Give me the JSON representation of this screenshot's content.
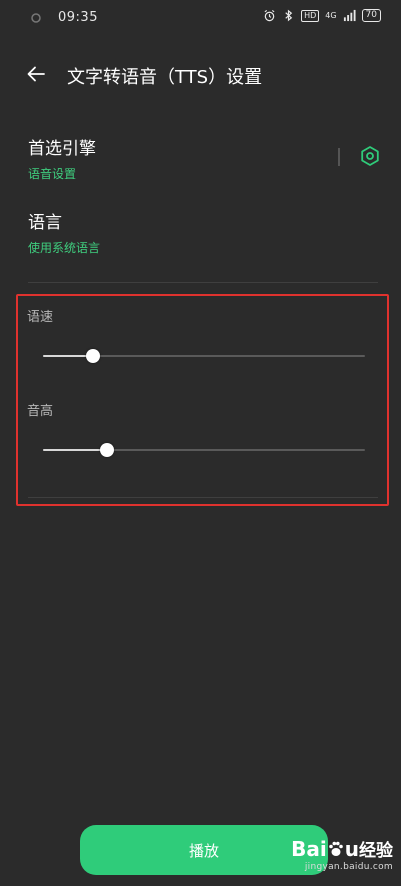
{
  "status_bar": {
    "time": "09:35",
    "hd_badge": "HD",
    "signal_text": "4G",
    "battery": "70",
    "icons": [
      "alarm-icon",
      "bluetooth-icon",
      "hd-badge",
      "signal-icon",
      "battery-icon"
    ]
  },
  "app_bar": {
    "title": "文字转语音（TTS）设置",
    "back_icon": "back-arrow-icon"
  },
  "engine": {
    "title": "首选引擎",
    "summary": "语音设置",
    "settings_icon": "gear-icon"
  },
  "language": {
    "title": "语言",
    "summary": "使用系统语言"
  },
  "speech_rate": {
    "label": "语速",
    "value": 0.155
  },
  "pitch": {
    "label": "音高",
    "value": 0.2
  },
  "play_button": {
    "label": "播放"
  },
  "watermark": {
    "logo_text": "Bai",
    "logo_text_2": "u",
    "logo_text_3": "经验",
    "url": "jingyan.baidu.com"
  },
  "colors": {
    "background": "#2b2b2b",
    "accent_green": "#2fcc7a",
    "summary_green": "#3fcf7f",
    "highlight_red": "#e0322e"
  }
}
